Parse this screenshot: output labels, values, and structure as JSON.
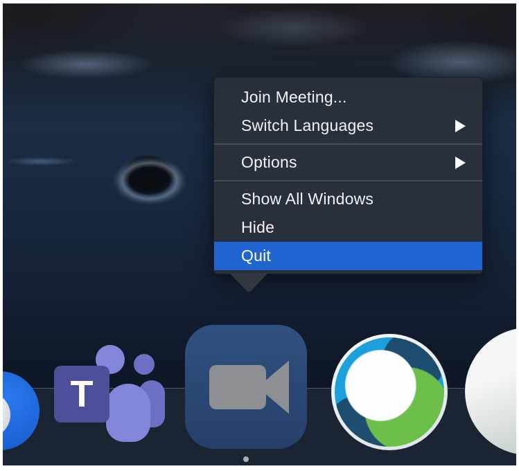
{
  "context_menu": {
    "items": [
      {
        "label": "Join Meeting...",
        "has_submenu": false,
        "highlighted": false
      },
      {
        "label": "Switch Languages",
        "has_submenu": true,
        "highlighted": false
      },
      {
        "label": "Options",
        "has_submenu": true,
        "highlighted": false
      },
      {
        "label": "Show All Windows",
        "has_submenu": false,
        "highlighted": false
      },
      {
        "label": "Hide",
        "has_submenu": false,
        "highlighted": false
      },
      {
        "label": "Quit",
        "has_submenu": false,
        "highlighted": true
      }
    ],
    "highlighted_item": "Quit",
    "colors": {
      "menu_bg": "#2a303b",
      "highlight": "#1f64d1",
      "separator": "#4a505b",
      "text": "#f2f4f6"
    }
  },
  "dock": {
    "teams_badge": "T",
    "apps": [
      {
        "name": "partial blue app",
        "icon": "blue-circle-icon"
      },
      {
        "name": "Microsoft Teams",
        "icon": "teams-people-icon"
      },
      {
        "name": "Zoom",
        "icon": "video-camera-icon",
        "running": true
      },
      {
        "name": "Cisco Webex Meetings",
        "icon": "webex-globe-icon"
      },
      {
        "name": "Cisco AnyConnect",
        "icon": "globe-swoosh-icon"
      }
    ],
    "colors": {
      "dock_bg": "#1b2433",
      "zoom_tile": "#2d4d80",
      "webex_cyan": "#1ba0dc",
      "webex_green": "#6cc04a",
      "teams_purple": "#8287d9"
    }
  }
}
